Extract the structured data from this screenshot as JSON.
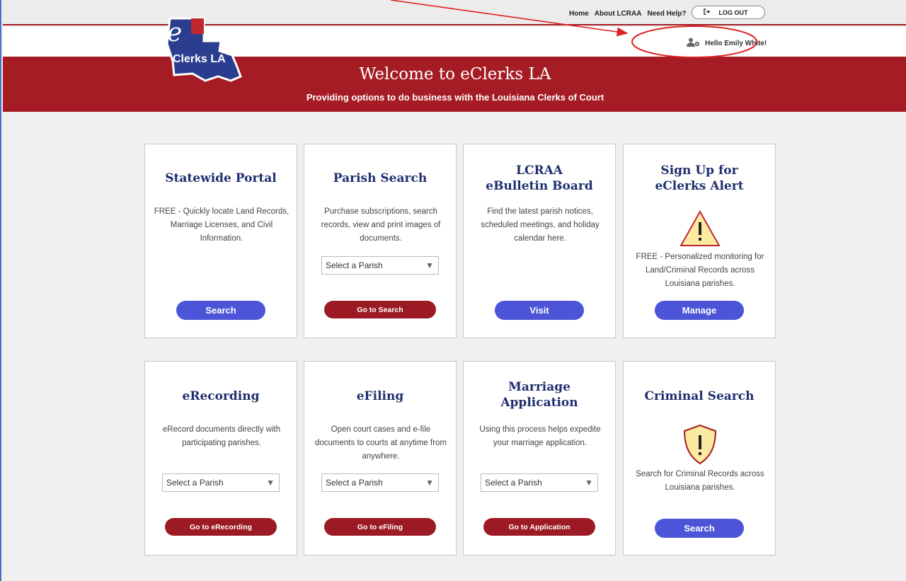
{
  "topnav": {
    "home": "Home",
    "about": "About LCRAA",
    "help": "Need Help?",
    "logout": "LOG OUT"
  },
  "user": {
    "greeting": "Hello Emily White!"
  },
  "logo": {
    "letter": "e",
    "text": "Clerks LA"
  },
  "hero": {
    "title": "Welcome to eClerks LA",
    "subtitle": "Providing options to do business with the Louisiana Clerks of Court"
  },
  "cards": [
    {
      "title": "Statewide Portal",
      "desc": "FREE - Quickly locate Land Records, Marriage Licenses, and Civil Information.",
      "button": "Search"
    },
    {
      "title": "Parish Search",
      "desc": "Purchase subscriptions, search records, view and print images of documents.",
      "select": "Select a Parish",
      "button": "Go to Search"
    },
    {
      "title_line1": "LCRAA",
      "title_line2": "eBulletin Board",
      "desc": "Find the latest parish notices, scheduled meetings, and holiday calendar here.",
      "button": "Visit"
    },
    {
      "title_line1": "Sign Up for",
      "title_line2": "eClerks Alert",
      "desc": "FREE - Personalized monitoring for Land/Criminal Records across Louisiana parishes.",
      "button": "Manage"
    },
    {
      "title": "eRecording",
      "desc": "eRecord documents directly with participating parishes.",
      "select": "Select a Parish",
      "button": "Go to eRecording"
    },
    {
      "title": "eFiling",
      "desc": "Open court cases and e-file documents to courts at anytime from anywhere.",
      "select": "Select a Parish",
      "button": "Go to eFiling"
    },
    {
      "title_line1": "Marriage",
      "title_line2": "Application",
      "desc": "Using this process helps expedite your marriage application.",
      "select": "Select a Parish",
      "button": "Go to Application"
    },
    {
      "title": "Criminal Search",
      "desc": "Search for Criminal Records across Louisiana parishes.",
      "button": "Search"
    }
  ],
  "colors": {
    "brand_red": "#a61c24",
    "button_blue": "#4c55d8",
    "button_red": "#9b1a24",
    "title_navy": "#1f2f6e",
    "annotation_red": "#e02020"
  },
  "icons": [
    "logout-icon",
    "user-settings-icon",
    "warning-triangle-icon",
    "warning-shield-icon",
    "dropdown-arrow-icon"
  ]
}
